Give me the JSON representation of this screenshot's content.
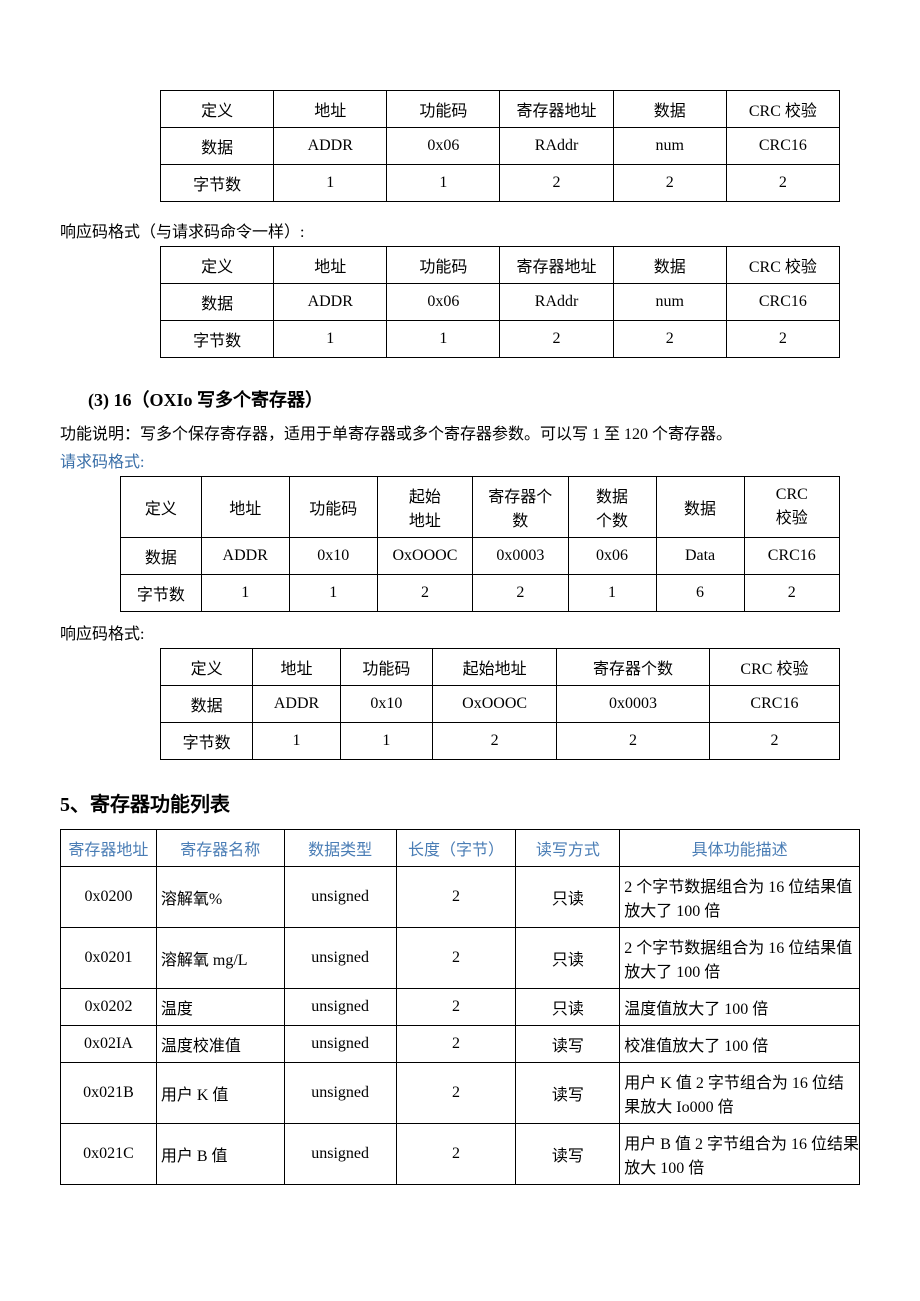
{
  "table1": {
    "headers": [
      "定义",
      "地址",
      "功能码",
      "寄存器地址",
      "数据",
      "CRC 校验"
    ],
    "row1": [
      "数据",
      "ADDR",
      "0x06",
      "RAddr",
      "num",
      "CRC16"
    ],
    "row2": [
      "字节数",
      "1",
      "1",
      "2",
      "2",
      "2"
    ]
  },
  "caption1": "响应码格式（与请求码命令一样）:",
  "table2": {
    "headers": [
      "定义",
      "地址",
      "功能码",
      "寄存器地址",
      "数据",
      "CRC 校验"
    ],
    "row1": [
      "数据",
      "ADDR",
      "0x06",
      "RAddr",
      "num",
      "CRC16"
    ],
    "row2": [
      "字节数",
      "1",
      "1",
      "2",
      "2",
      "2"
    ]
  },
  "section3": "(3)  16（OXIo 写多个寄存器）",
  "desc3": "功能说明：写多个保存寄存器，适用于单寄存器或多个寄存器参数。可以写 1 至 120 个寄存器。",
  "label_request": "请求码格式:",
  "table3": {
    "h0": "定义",
    "h1": "地址",
    "h2": "功能码",
    "h3": "起始\n地址",
    "h4": "寄存器个\n数",
    "h5": "数据\n个数",
    "h6": "数据",
    "h7": "CRC\n校验",
    "r1": [
      "数据",
      "ADDR",
      "0x10",
      "OxOOOC",
      "0x0003",
      "0x06",
      "Data",
      "CRC16"
    ],
    "r2": [
      "字节数",
      "1",
      "1",
      "2",
      "2",
      "1",
      "6",
      "2"
    ]
  },
  "label_response": "响应码格式:",
  "table4": {
    "headers": [
      "定义",
      "地址",
      "功能码",
      "起始地址",
      "寄存器个数",
      "CRC 校验"
    ],
    "row1": [
      "数据",
      "ADDR",
      "0x10",
      "OxOOOC",
      "0x0003",
      "CRC16"
    ],
    "row2": [
      "字节数",
      "1",
      "1",
      "2",
      "2",
      "2"
    ]
  },
  "h5_title": "5、寄存器功能列表",
  "regtable": {
    "headers": [
      "寄存器地址",
      "寄存器名称",
      "数据类型",
      "长度（字节）",
      "读写方式",
      "具体功能描述"
    ],
    "rows": [
      [
        "0x0200",
        "溶解氧%",
        "unsigned",
        "2",
        "只读",
        "2 个字节数据组合为 16 位结果值放大了 100 倍"
      ],
      [
        "0x0201",
        "溶解氧 mg/L",
        "unsigned",
        "2",
        "只读",
        "2 个字节数据组合为 16 位结果值放大了 100 倍"
      ],
      [
        "0x0202",
        "温度",
        "unsigned",
        "2",
        "只读",
        "温度值放大了 100 倍"
      ],
      [
        "0x02IA",
        "温度校准值",
        "unsigned",
        "2",
        "读写",
        "校准值放大了 100 倍"
      ],
      [
        "0x021B",
        "用户 K 值",
        "unsigned",
        "2",
        "读写",
        "用户 K 值 2 字节组合为 16 位结果放大 Io000 倍"
      ],
      [
        "0x021C",
        "用户 B 值",
        "unsigned",
        "2",
        "读写",
        "用户 B 值 2 字节组合为 16 位结果放大 100 倍"
      ]
    ]
  }
}
